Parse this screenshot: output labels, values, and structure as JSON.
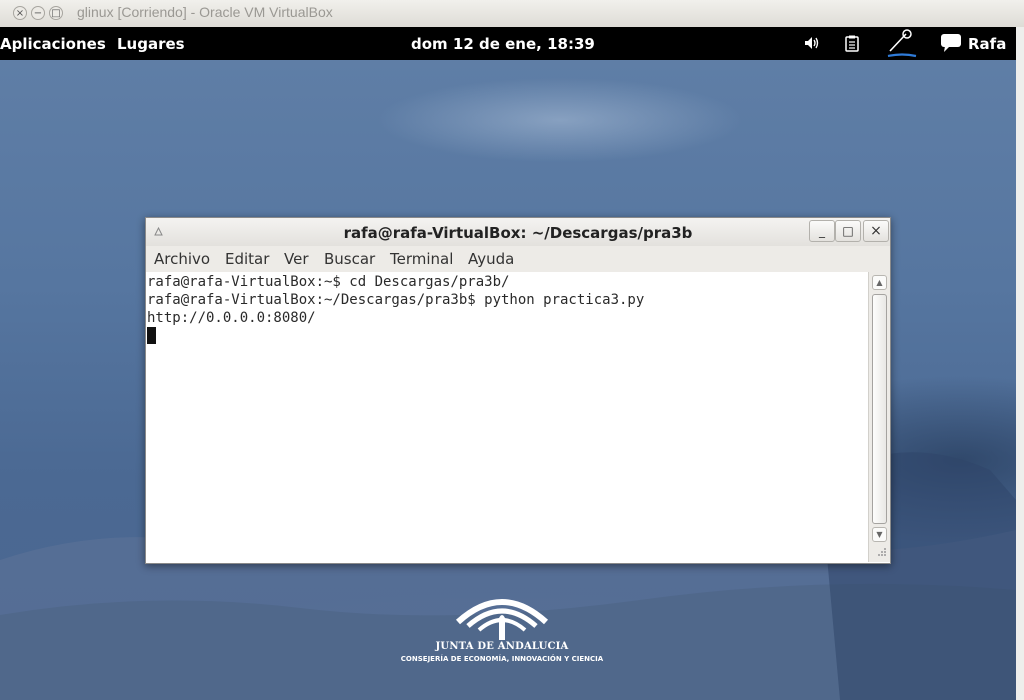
{
  "host_window": {
    "title": "glinux [Corriendo] - Oracle VM VirtualBox",
    "controls": [
      "×",
      "−",
      "□"
    ]
  },
  "top_panel": {
    "applications": "Aplicaciones",
    "places": "Lugares",
    "clock": "dom 12 de ene, 18:39",
    "user": "Rafa",
    "icons": [
      "volume-icon",
      "clipboard-icon",
      "network-pen-icon",
      "chat-icon"
    ]
  },
  "terminal": {
    "title": "rafa@rafa-VirtualBox: ~/Descargas/pra3b",
    "window_buttons": {
      "minimize": "_",
      "maximize": "□",
      "close": "×"
    },
    "menu": [
      "Archivo",
      "Editar",
      "Ver",
      "Buscar",
      "Terminal",
      "Ayuda"
    ],
    "lines": [
      "rafa@rafa-VirtualBox:~$ cd Descargas/pra3b/",
      "rafa@rafa-VirtualBox:~/Descargas/pra3b$ python practica3.py",
      "http://0.0.0.0:8080/"
    ]
  },
  "logo": {
    "name": "JUNTA DE ANDALUCIA",
    "subtitle": "CONSEJERÍA DE ECONOMÍA, INNOVACIÓN Y CIENCIA"
  },
  "colors": {
    "panel": "#000000",
    "desktop": "#5676a0",
    "terminal_bg": "#ffffff"
  }
}
